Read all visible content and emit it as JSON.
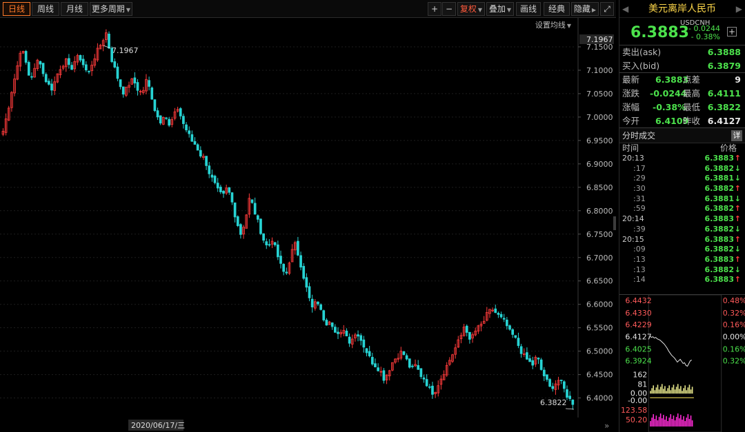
{
  "toolbar": {
    "periods": [
      "日线",
      "周线",
      "月线",
      "更多周期"
    ],
    "zoom_in": "+",
    "zoom_out": "−",
    "adjust": "复权",
    "overlay": "叠加",
    "draw": "画线",
    "classic": "经典",
    "hide": "隐藏",
    "expand": "⤢"
  },
  "chart": {
    "ma_settings": "设置均线",
    "x_cursor_label": "2020/06/17/三",
    "high_label": "7.1967",
    "low_label": "6.3822",
    "axis_top_label": "7.1967"
  },
  "chart_data": {
    "type": "candlestick",
    "title": "",
    "ylim": [
      6.37,
      7.2
    ],
    "yticks": [
      "7.1500",
      "7.1000",
      "7.0500",
      "7.0000",
      "6.9500",
      "6.9000",
      "6.8500",
      "6.8000",
      "6.7500",
      "6.7000",
      "6.6500",
      "6.6000",
      "6.5500",
      "6.5000",
      "6.4500",
      "6.4000"
    ],
    "ytick_values": [
      7.15,
      7.1,
      7.05,
      7.0,
      6.95,
      6.9,
      6.85,
      6.8,
      6.75,
      6.7,
      6.65,
      6.6,
      6.55,
      6.5,
      6.45,
      6.4
    ],
    "max": 7.1967,
    "min": 6.3822,
    "up_color": "#ff3b3b",
    "down_color": "#27d3d3",
    "close_series": [
      6.97,
      7.01,
      7.06,
      7.1,
      7.15,
      7.12,
      7.08,
      7.1,
      7.13,
      7.09,
      7.07,
      7.06,
      7.09,
      7.11,
      7.12,
      7.1,
      7.12,
      7.13,
      7.11,
      7.09,
      7.12,
      7.14,
      7.16,
      7.18,
      7.13,
      7.1,
      7.07,
      7.05,
      7.07,
      7.08,
      7.06,
      7.05,
      7.08,
      7.05,
      7.01,
      6.99,
      7.01,
      6.98,
      7.0,
      7.02,
      6.99,
      6.97,
      6.95,
      6.94,
      6.92,
      6.91,
      6.88,
      6.86,
      6.84,
      6.83,
      6.85,
      6.82,
      6.78,
      6.75,
      6.78,
      6.83,
      6.8,
      6.77,
      6.74,
      6.72,
      6.74,
      6.71,
      6.68,
      6.66,
      6.7,
      6.73,
      6.7,
      6.66,
      6.62,
      6.59,
      6.61,
      6.58,
      6.56,
      6.57,
      6.54,
      6.53,
      6.55,
      6.52,
      6.53,
      6.54,
      6.52,
      6.5,
      6.48,
      6.47,
      6.46,
      6.44,
      6.46,
      6.48,
      6.49,
      6.5,
      6.48,
      6.46,
      6.47,
      6.45,
      6.44,
      6.42,
      6.41,
      6.43,
      6.45,
      6.47,
      6.49,
      6.51,
      6.53,
      6.56,
      6.52,
      6.54,
      6.55,
      6.56,
      6.58,
      6.59,
      6.58,
      6.57,
      6.56,
      6.54,
      6.53,
      6.51,
      6.49,
      6.48,
      6.47,
      6.49,
      6.46,
      6.44,
      6.42,
      6.43,
      6.44,
      6.42,
      6.4,
      6.39
    ]
  },
  "panel": {
    "title": "美元离岸人民币",
    "prev_nav": "◀",
    "next_nav": "▶",
    "symbol": "USDCNH",
    "last": "6.3883",
    "change": "- 0.0244",
    "change_pct": "- 0.38%",
    "add": "+",
    "ask_label": "卖出(ask)",
    "ask": "6.3888",
    "bid_label": "买入(bid)",
    "bid": "6.3879",
    "stats": {
      "latest_label": "最新",
      "latest": "6.3883",
      "spread_label": "点差",
      "spread": "9",
      "chg_label": "涨跌",
      "chg": "-0.0244",
      "high_label": "最高",
      "high": "6.4111",
      "chgpct_label": "涨幅",
      "chgpct": "-0.38%",
      "low_label": "最低",
      "low": "6.3822",
      "open_label": "今开",
      "open": "6.4109",
      "prev_label": "昨收",
      "prev": "6.4127"
    },
    "ticks_title": "分时成交",
    "ticks_detail": "详",
    "col_time": "时间",
    "col_price": "价格",
    "ticks": [
      {
        "time": "20:13",
        "price": "6.3883",
        "dir": "↑",
        "sub": false
      },
      {
        "time": ":17",
        "price": "6.3882",
        "dir": "↓",
        "sub": true
      },
      {
        "time": ":29",
        "price": "6.3881",
        "dir": "↓",
        "sub": true
      },
      {
        "time": ":30",
        "price": "6.3882",
        "dir": "↑",
        "sub": true
      },
      {
        "time": ":31",
        "price": "6.3881",
        "dir": "↓",
        "sub": true
      },
      {
        "time": ":59",
        "price": "6.3882",
        "dir": "↑",
        "sub": true
      },
      {
        "time": "20:14",
        "price": "6.3883",
        "dir": "↑",
        "sub": false
      },
      {
        "time": ":39",
        "price": "6.3882",
        "dir": "↓",
        "sub": true
      },
      {
        "time": "20:15",
        "price": "6.3883",
        "dir": "↑",
        "sub": false
      },
      {
        "time": ":09",
        "price": "6.3882",
        "dir": "↓",
        "sub": true
      },
      {
        "time": ":13",
        "price": "6.3883",
        "dir": "↑",
        "sub": true
      },
      {
        "time": ":13",
        "price": "6.3882",
        "dir": "↓",
        "sub": true
      },
      {
        "time": ":14",
        "price": "6.3883",
        "dir": "↑",
        "sub": true
      }
    ],
    "mini": {
      "left_labels": [
        "6.4432",
        "6.4330",
        "6.4229",
        "6.4127",
        "6.4025",
        "6.3924"
      ],
      "right_labels": [
        "0.48%",
        "0.32%",
        "0.16%",
        "0.00%",
        "0.16%",
        "0.32%"
      ],
      "vol_labels": [
        "162",
        "81",
        "0.00",
        "-0.00",
        "123.58",
        "50.20"
      ]
    }
  }
}
